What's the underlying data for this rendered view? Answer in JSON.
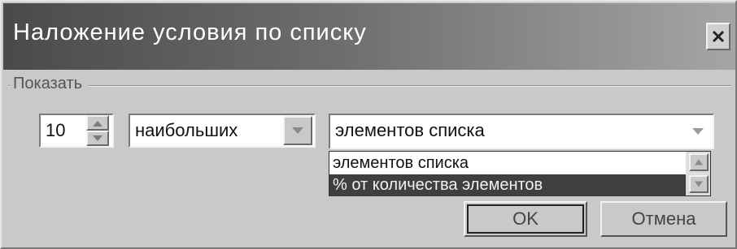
{
  "dialog": {
    "title": "Наложение условия по списку",
    "group_label": "Показать"
  },
  "count_spinner": {
    "value": "10"
  },
  "order_select": {
    "value": "наибольших"
  },
  "type_select": {
    "value": "элементов списка",
    "options": [
      {
        "label": "элементов списка",
        "selected": false
      },
      {
        "label": "% от количества элементов",
        "selected": true
      }
    ]
  },
  "buttons": {
    "ok": "OK",
    "cancel": "Отмена"
  },
  "icons": {
    "close": "close-icon",
    "spin_up": "arrow-up-icon",
    "spin_down": "arrow-down-icon",
    "dropdown": "chevron-down-icon",
    "scroll_up": "scroll-up-icon",
    "scroll_down": "scroll-down-icon"
  },
  "colors": {
    "titlebar_start": "#4a4a4a",
    "titlebar_end": "#a5a5a5",
    "selection": "#3f3f3f"
  }
}
